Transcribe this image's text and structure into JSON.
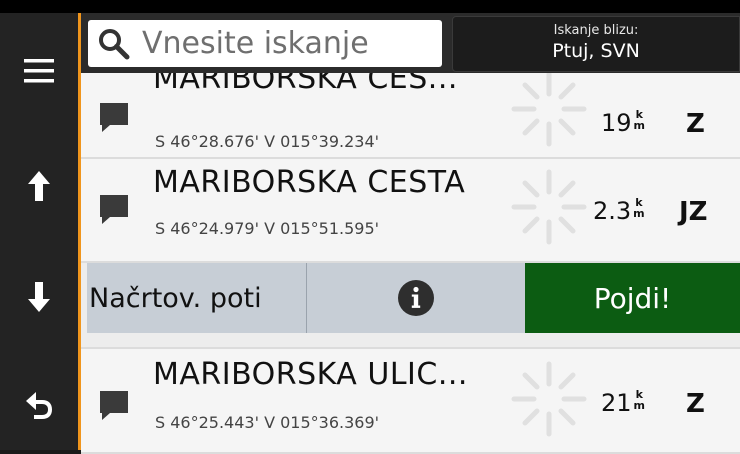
{
  "sidebar": {
    "buttons": [
      {
        "name": "menu",
        "icon": "hamburger-menu-icon"
      },
      {
        "name": "scroll-up",
        "icon": "arrow-up-icon"
      },
      {
        "name": "scroll-down",
        "icon": "arrow-down-icon"
      },
      {
        "name": "back",
        "icon": "back-arrow-icon"
      }
    ],
    "accent_color": "#f0951c"
  },
  "search": {
    "placeholder": "Vnesite iskanje",
    "icon": "search-icon"
  },
  "near": {
    "label": "Iskanje blizu:",
    "value": "Ptuj, SVN"
  },
  "results": [
    {
      "title": "MARIBORSKA CES...",
      "coords": "S 46°28.676' V 015°39.234'",
      "distance": "19",
      "unit_top": "k",
      "unit_bottom": "m",
      "direction": "Z",
      "icon": "location-pin-icon"
    },
    {
      "title": "MARIBORSKA CESTA",
      "coords": "S 46°24.979' V 015°51.595'",
      "distance": "2.3",
      "unit_top": "k",
      "unit_bottom": "m",
      "direction": "JZ",
      "icon": "location-pin-icon"
    },
    {
      "title": "MARIBORSKA ULIC...",
      "coords": "S 46°25.443' V 015°36.369'",
      "distance": "21",
      "unit_top": "k",
      "unit_bottom": "m",
      "direction": "Z",
      "icon": "location-pin-icon"
    }
  ],
  "actions": {
    "plan_label": "Načrtov. poti",
    "info_icon": "info-icon",
    "go_label": "Pojdi!",
    "go_color": "#0c5c12"
  }
}
